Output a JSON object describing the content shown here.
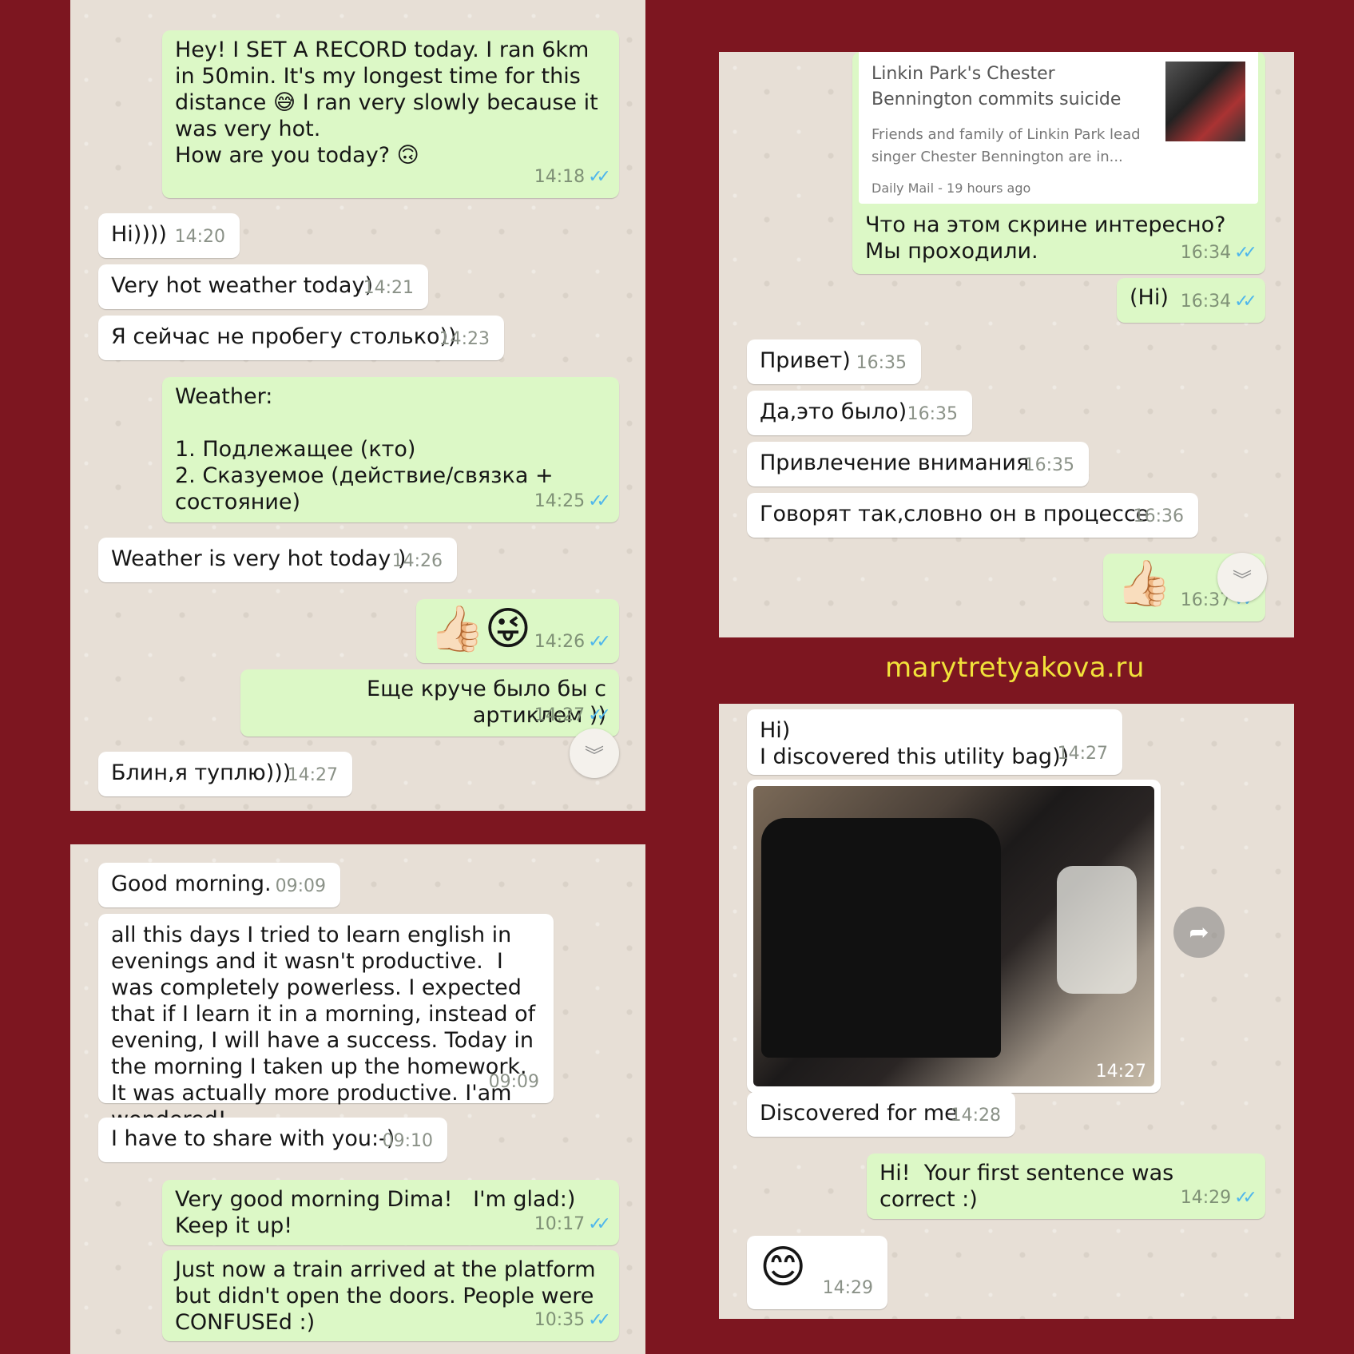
{
  "panel1": {
    "messages": [
      {
        "type": "out",
        "text": "Hey! I SET A RECORD today. I ran 6km in 50min. It's my longest time for this distance 😅 I ran very slowly because it was very hot.\nHow are you today? 🙃",
        "time": "14:18"
      },
      {
        "type": "in",
        "text": "Hi))))",
        "time": "14:20"
      },
      {
        "type": "in",
        "text": "Very hot weather today)",
        "time": "14:21"
      },
      {
        "type": "in",
        "text": "Я сейчас не пробегу столько))",
        "time": "14:23"
      },
      {
        "type": "out",
        "text": "Weather:\n\n1. Подлежащее (кто)\n2. Сказуемое (действие/связка + состояние)",
        "time": "14:25"
      },
      {
        "type": "in",
        "text": "Weather is very hot today )",
        "time": "14:26"
      },
      {
        "type": "out",
        "text": "👍🏻😜",
        "time": "14:26"
      },
      {
        "type": "out",
        "text": "Еще круче было бы с артиклем ))",
        "time": "14:27"
      },
      {
        "type": "in",
        "text": "Блин,я туплю)))",
        "time": "14:27"
      }
    ]
  },
  "panel2": {
    "link_preview": {
      "title": "Linkin Park's Chester Bennington commits suicide",
      "description": "Friends and family of Linkin Park lead singer Chester Bennington are in...",
      "source": "Daily Mail - 19 hours ago"
    },
    "messages": [
      {
        "type": "out",
        "text": "Что на этом скрине интересно? Мы проходили.",
        "time": "16:34"
      },
      {
        "type": "out",
        "text": "(Hi)",
        "time": "16:34"
      },
      {
        "type": "in",
        "text": "Привет)",
        "time": "16:35"
      },
      {
        "type": "in",
        "text": "Да,это было)",
        "time": "16:35"
      },
      {
        "type": "in",
        "text": "Привлечение внимания",
        "time": "16:35"
      },
      {
        "type": "in",
        "text": "Говорят так,словно он в процессе",
        "time": "16:36"
      },
      {
        "type": "out",
        "text": "👍🏻",
        "time": "16:37"
      }
    ]
  },
  "panel3": {
    "messages": [
      {
        "type": "in",
        "text": "Good morning.",
        "time": "09:09"
      },
      {
        "type": "in",
        "text": "all this days I tried to learn english in evenings and it wasn't productive.  I was completely powerless. I expected that if I learn it in a morning, instead of evening, I will have a success. Today in the morning I taken up the homework. It was actually more productive. I'am wondered!",
        "time": "09:09"
      },
      {
        "type": "in",
        "text": "I have to share with you:-)",
        "time": "09:10"
      },
      {
        "type": "out",
        "text": "Very good morning Dima!   I'm glad:) Keep it up!",
        "time": "10:17"
      },
      {
        "type": "out",
        "text": "Just now a train arrived at the platform but didn't open the doors. People were CONFUSEd :)",
        "time": "10:35"
      }
    ]
  },
  "panel4": {
    "messages": [
      {
        "type": "in",
        "text": "Hi)\nI discovered this utility bag))",
        "time": "14:27"
      },
      {
        "type": "in",
        "text": "Discovered for me",
        "time": "14:28"
      },
      {
        "type": "out",
        "text": "Hi!  Your first sentence was correct :)",
        "time": "14:29"
      },
      {
        "type": "in",
        "text": "😊",
        "time": "14:29"
      }
    ],
    "photo_time": "14:27"
  },
  "watermark": "marytretyakova.ru",
  "icons": {
    "read_ticks": "double-check-icon",
    "scroll_down": "chevron-double-down-icon",
    "forward": "share-forward-icon"
  },
  "colors": {
    "background": "#7d1620",
    "chat_bg": "#e7dfd6",
    "outgoing_bubble": "#dcf8c6",
    "incoming_bubble": "#ffffff",
    "tick_blue": "#4fb6ec",
    "watermark": "#f1e23a"
  }
}
